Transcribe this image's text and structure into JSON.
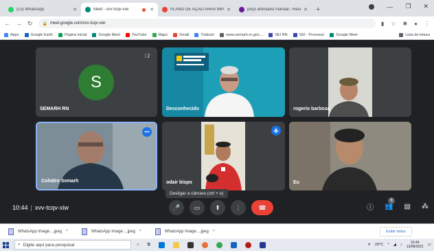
{
  "tabs": [
    {
      "title": "(13) WhatsApp",
      "color": "#25d366",
      "active": false
    },
    {
      "title": "Meet - xvv-tcqv-xiw",
      "color": "#00897b",
      "active": true,
      "recording": true
    },
    {
      "title": "PLANO DE AÇÃO PARA IMPLAN",
      "color": "#ea4335",
      "active": false
    },
    {
      "title": "poço artesiano manual - Resulta",
      "color": "#6a1b9a",
      "active": false
    }
  ],
  "address": "meet.google.com/xvv-tcqv-xiw",
  "bookmarks": [
    {
      "label": "Apps",
      "color": "#4285f4"
    },
    {
      "label": "Google Earth",
      "color": "#1565c0"
    },
    {
      "label": "Página inicial",
      "color": "#0f9d58"
    },
    {
      "label": "Google Meet",
      "color": "#00897b"
    },
    {
      "label": "YouTube",
      "color": "#ff0000"
    },
    {
      "label": "Maps",
      "color": "#34a853"
    },
    {
      "label": "Gmail",
      "color": "#ea4335"
    },
    {
      "label": "Traduzir",
      "color": "#4285f4"
    },
    {
      "label": "www.semarh.rn.gov....",
      "color": "#5f6368"
    },
    {
      "label": "SEI RN",
      "color": "#3949ab"
    },
    {
      "label": "SEI - Processo",
      "color": "#3949ab"
    },
    {
      "label": "Google Meet",
      "color": "#00897b"
    }
  ],
  "reading_list": "Lista de leitura",
  "participants": [
    {
      "name": "SEMARH RN",
      "initial": "S"
    },
    {
      "name": "Desconhecido"
    },
    {
      "name": "rogerio barbosa"
    },
    {
      "name": "Cohidro Semarh"
    },
    {
      "name": "odair bispo"
    },
    {
      "name": "Eu"
    }
  ],
  "tooltip": "Desligar a câmara (ctrl + e)",
  "meeting": {
    "time": "10:44",
    "code": "xvv-tcqv-xiw",
    "participant_count": "6"
  },
  "downloads": [
    {
      "name": "WhatsApp Image....jpeg"
    },
    {
      "name": "WhatsApp Image....jpeg"
    },
    {
      "name": "WhatsApp Image....jpeg"
    }
  ],
  "downloads_show_all": "Exibir todos",
  "taskbar": {
    "search_placeholder": "Digite aqui para pesquisar",
    "weather": "29°C",
    "time": "10:44",
    "date": "13/09/2021"
  }
}
